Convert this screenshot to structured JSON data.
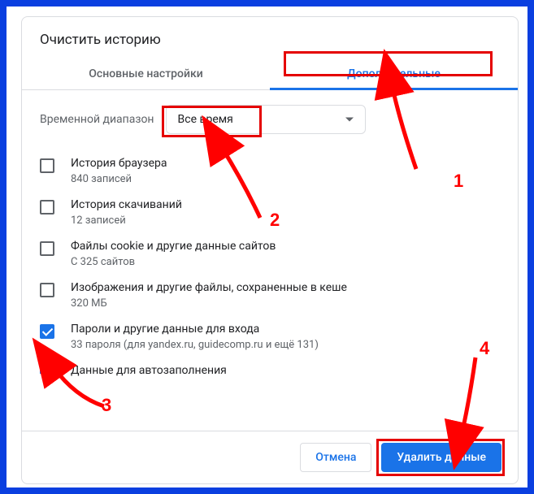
{
  "title": "Очистить историю",
  "tabs": {
    "basic": "Основные настройки",
    "advanced": "Дополнительные"
  },
  "time_range": {
    "label": "Временной диапазон",
    "value": "Все время"
  },
  "items": [
    {
      "title": "История браузера",
      "sub": "840 записей",
      "checked": false
    },
    {
      "title": "История скачиваний",
      "sub": "12 записей",
      "checked": false
    },
    {
      "title": "Файлы cookie и другие данные сайтов",
      "sub": "С 325 сайтов",
      "checked": false
    },
    {
      "title": "Изображения и другие файлы, сохраненные в кеше",
      "sub": "320 МБ",
      "checked": false
    },
    {
      "title": "Пароли и другие данные для входа",
      "sub": "33 пароля (для yandex.ru, guidecomp.ru и ещё 131)",
      "checked": true
    },
    {
      "title": "Данные для автозаполнения",
      "sub": "",
      "checked": true
    }
  ],
  "footer": {
    "cancel": "Отмена",
    "confirm": "Удалить данные"
  },
  "annotations": {
    "n1": "1",
    "n2": "2",
    "n3": "3",
    "n4": "4"
  }
}
